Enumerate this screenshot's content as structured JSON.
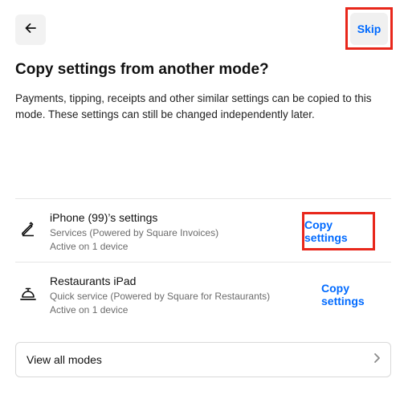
{
  "header": {
    "back_icon": "arrow-left-icon",
    "skip_label": "Skip"
  },
  "title": "Copy settings from another mode?",
  "description": "Payments, tipping, receipts and other similar settings can be copied to this mode. These settings can still be changed independently later.",
  "modes": [
    {
      "icon": "pencil-icon",
      "name": "iPhone (99)’s settings",
      "type": "Services (Powered by Square Invoices)",
      "devices": "Active on 1 device",
      "action": "Copy settings"
    },
    {
      "icon": "service-bell-icon",
      "name": "Restaurants iPad",
      "type": "Quick service (Powered by Square for Restaurants)",
      "devices": "Active on 1 device",
      "action": "Copy settings"
    }
  ],
  "view_all": {
    "label": "View all modes",
    "icon": "chevron-right-icon"
  },
  "colors": {
    "accent": "#006aff",
    "highlight": "#e8271b"
  }
}
